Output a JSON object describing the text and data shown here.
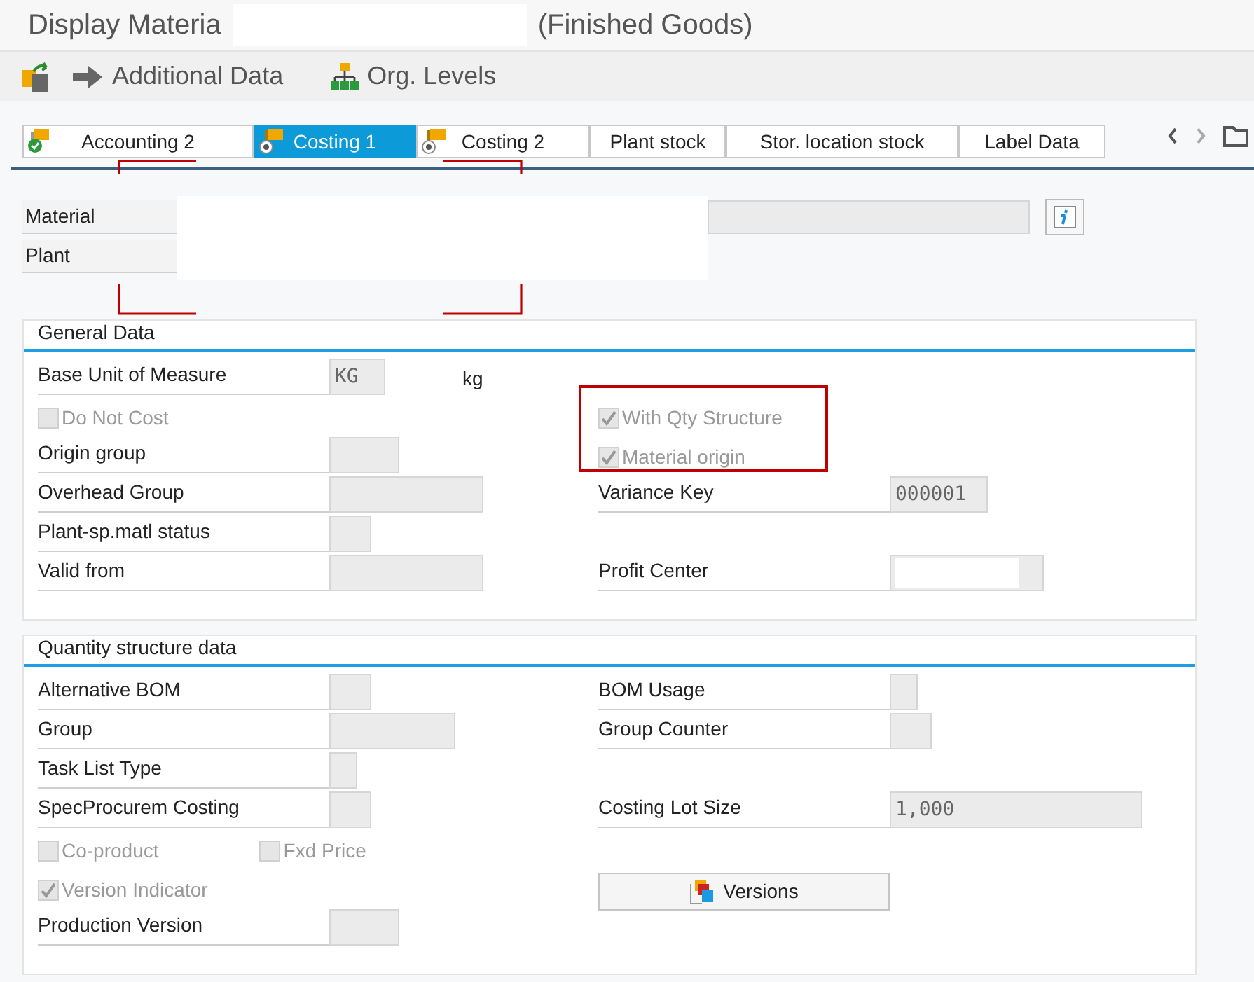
{
  "window": {
    "title_parts": [
      "Display Materia",
      "(Finished Goods)"
    ]
  },
  "toolbar": [
    {
      "label": "Additional Data",
      "kind": "arrow"
    },
    {
      "label": "Org. Levels",
      "kind": "hierarchy"
    }
  ],
  "tabs": [
    {
      "label": "Accounting 2",
      "selected": false,
      "kind": "check"
    },
    {
      "label": "Costing 1",
      "selected": true,
      "kind": "dot"
    },
    {
      "label": "Costing 2",
      "selected": false,
      "kind": "dot"
    },
    {
      "label": "Plant stock",
      "selected": false,
      "kind": "plain"
    },
    {
      "label": "Stor. location stock",
      "selected": false,
      "kind": "plain"
    },
    {
      "label": "Label Data",
      "selected": false,
      "kind": "plain"
    }
  ],
  "header_fields": [
    {
      "label": "Material"
    },
    {
      "label": "Plant"
    }
  ],
  "sections": [
    {
      "title": "General Data",
      "rows": [
        {
          "left": [
            {
              "kind": "field",
              "label": "Base Unit of Measure",
              "value": "KG",
              "unit": "kg"
            }
          ],
          "right": []
        },
        {
          "left": [
            {
              "kind": "checkbox",
              "label": "Do Not Cost",
              "checked": false,
              "disabled": true
            }
          ],
          "right": [
            {
              "kind": "checkbox",
              "label": "With Qty Structure",
              "checked": true,
              "disabled": true
            }
          ]
        },
        {
          "left": [
            {
              "kind": "field",
              "label": "Origin group"
            }
          ],
          "right": [
            {
              "kind": "checkbox",
              "label": "Material origin",
              "checked": true,
              "disabled": true
            }
          ]
        },
        {
          "left": [
            {
              "kind": "field",
              "label": "Overhead Group"
            }
          ],
          "right": [
            {
              "kind": "field",
              "label": "Variance Key",
              "value": "000001"
            }
          ]
        },
        {
          "left": [
            {
              "kind": "field",
              "label": "Plant-sp.matl status"
            }
          ],
          "right": []
        },
        {
          "left": [
            {
              "kind": "field",
              "label": "Valid from"
            }
          ],
          "right": [
            {
              "kind": "field",
              "label": "Profit Center"
            }
          ]
        }
      ]
    },
    {
      "title": "Quantity structure data",
      "rows": [
        {
          "left": [
            {
              "kind": "field",
              "label": "Alternative BOM"
            }
          ],
          "right": [
            {
              "kind": "field",
              "label": "BOM Usage"
            }
          ]
        },
        {
          "left": [
            {
              "kind": "field",
              "label": "Group"
            }
          ],
          "right": [
            {
              "kind": "field",
              "label": "Group Counter"
            }
          ]
        },
        {
          "left": [
            {
              "kind": "field",
              "label": "Task List Type"
            }
          ],
          "right": []
        },
        {
          "left": [
            {
              "kind": "field",
              "label": "SpecProcurem Costing"
            }
          ],
          "right": [
            {
              "kind": "field",
              "label": "Costing Lot Size",
              "value": "1,000"
            }
          ]
        },
        {
          "left": [
            {
              "kind": "checkbox",
              "label": "Co-product",
              "checked": false,
              "disabled": true
            },
            {
              "kind": "checkbox",
              "label": "Fxd Price",
              "checked": false,
              "disabled": true
            }
          ],
          "right": []
        },
        {
          "left": [
            {
              "kind": "checkbox",
              "label": "Version Indicator",
              "checked": true,
              "disabled": true
            }
          ],
          "right": [
            {
              "kind": "button",
              "label": "Versions"
            }
          ]
        },
        {
          "left": [
            {
              "kind": "field",
              "label": "Production Version"
            }
          ],
          "right": []
        }
      ]
    }
  ]
}
